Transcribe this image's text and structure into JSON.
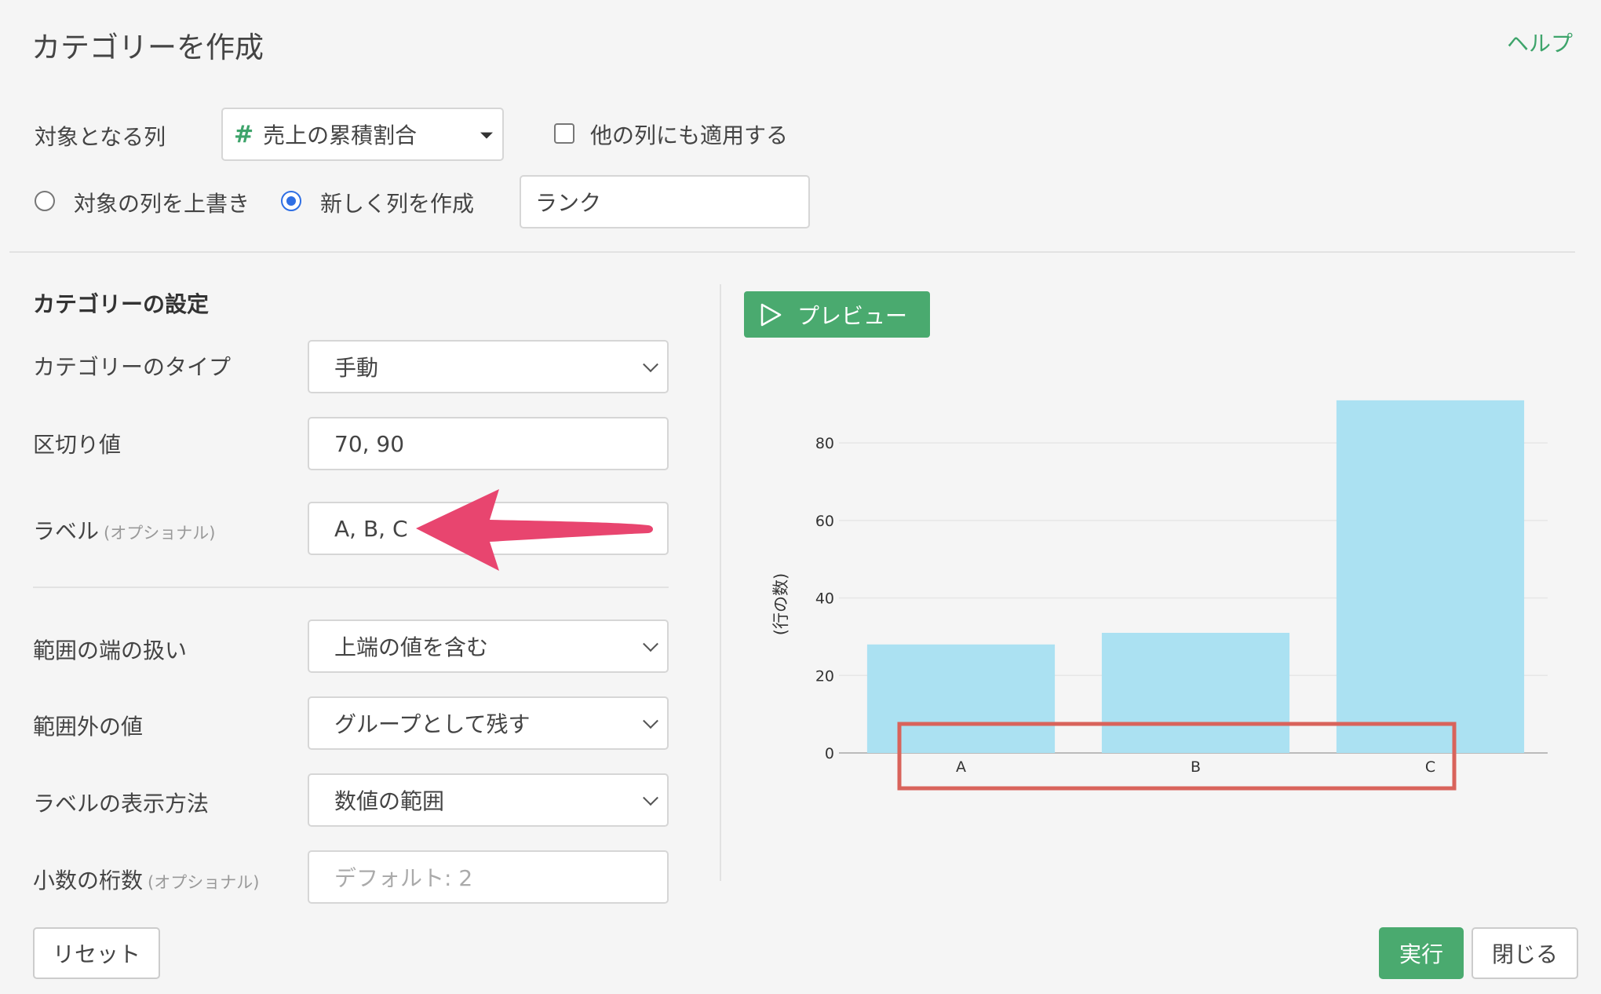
{
  "header": {
    "title": "カテゴリーを作成",
    "help_label": "ヘルプ"
  },
  "target": {
    "label": "対象となる列",
    "column_icon": "#",
    "column_value": "売上の累積割合",
    "apply_other_label": "他の列にも適用する",
    "overwrite_label": "対象の列を上書き",
    "create_new_label": "新しく列を作成",
    "new_column_name": "ランク",
    "selected_mode": "create_new"
  },
  "settings": {
    "section_title": "カテゴリーの設定",
    "type_label": "カテゴリーのタイプ",
    "type_value": "手動",
    "breaks_label": "区切り値",
    "breaks_value": "70, 90",
    "labels_label": "ラベル",
    "optional_text": "(オプショナル)",
    "labels_value": "A, B, C",
    "edge_label": "範囲の端の扱い",
    "edge_value": "上端の値を含む",
    "outside_label": "範囲外の値",
    "outside_value": "グループとして残す",
    "display_label": "ラベルの表示方法",
    "display_value": "数値の範囲",
    "decimals_label": "小数の桁数",
    "decimals_placeholder": "デフォルト: 2"
  },
  "preview": {
    "button_label": "プレビュー"
  },
  "footer": {
    "reset_label": "リセット",
    "run_label": "実行",
    "close_label": "閉じる"
  },
  "colors": {
    "accent_green": "#4aaa6f",
    "bar_color": "#abe1f2",
    "arrow_color": "#e8456f",
    "highlight_box": "#d9635b"
  },
  "chart_data": {
    "type": "bar",
    "categories": [
      "A",
      "B",
      "C"
    ],
    "values": [
      28,
      31,
      91
    ],
    "ylabel": "(行の数)",
    "yticks": [
      0,
      20,
      40,
      60,
      80
    ],
    "ylim": [
      0,
      93
    ],
    "grid": true
  }
}
